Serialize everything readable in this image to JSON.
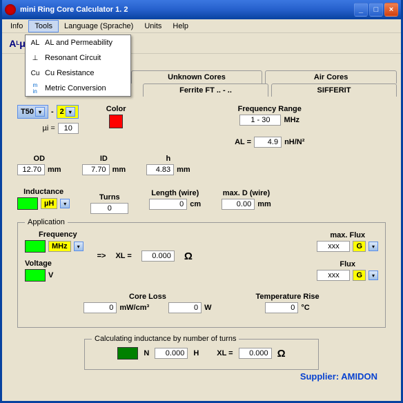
{
  "window": {
    "title": "mini Ring Core Calculator 1. 2"
  },
  "menu": {
    "info": "Info",
    "tools": "Tools",
    "language": "Language (Sprache)",
    "units": "Units",
    "help": "Help"
  },
  "tools_menu": {
    "al": "AL and Permeability",
    "resonant": "Resonant Circuit",
    "cu": "Cu Resistance",
    "metric": "Metric Conversion"
  },
  "tabs": {
    "unknown": "Unknown Cores",
    "air": "Air Cores"
  },
  "subtabs": {
    "ferrite": "Ferrite FT .. - ..",
    "sifferit": "SIFFERIT"
  },
  "main": {
    "core_size": "T50",
    "dash": "-",
    "core_color_num": "2",
    "mu_label": "µi =",
    "mu_val": "10",
    "color_label": "Color",
    "freq_range_label": "Frequency Range",
    "freq_range_val": "1 - 30",
    "freq_unit": "MHz",
    "al_label": "AL  =",
    "al_val": "4.9",
    "al_unit": "nH/N²",
    "od_label": "OD",
    "od_val": "12.70",
    "mm": "mm",
    "id_label": "ID",
    "id_val": "7.70",
    "h_label": "h",
    "h_val": "4.83",
    "inductance_label": "Inductance",
    "ind_unit": "µH",
    "turns_label": "Turns",
    "turns_val": "0",
    "len_label": "Length (wire)",
    "len_val": "0",
    "cm": "cm",
    "maxd_label": "max. D (wire)",
    "maxd_val": "0.00"
  },
  "app": {
    "legend": "Application",
    "freq_label": "Frequency",
    "freq_unit": "MHz",
    "arrow": "=>",
    "xl_label": "XL  =",
    "xl_val": "0.000",
    "ohm": "Ω",
    "volt_label": "Voltage",
    "volt_unit": "V",
    "maxflux_label": "max. Flux",
    "maxflux_val": "xxx",
    "gauss": "G",
    "flux_label": "Flux",
    "flux_val": "xxx",
    "coreloss_label": "Core Loss",
    "cl_val1": "0",
    "cl_unit1": "mW/cm³",
    "cl_val2": "0",
    "cl_unit2": "W",
    "temp_label": "Temperature Rise",
    "temp_val": "0",
    "temp_unit": "°C"
  },
  "calc": {
    "legend": "Calculating inductance by number of turns",
    "n": "N",
    "h_val": "0.000",
    "h_unit": "H",
    "xl_label": "XL  =",
    "xl_val": "0.000",
    "ohm": "Ω"
  },
  "footer": "Supplier: AMIDON"
}
